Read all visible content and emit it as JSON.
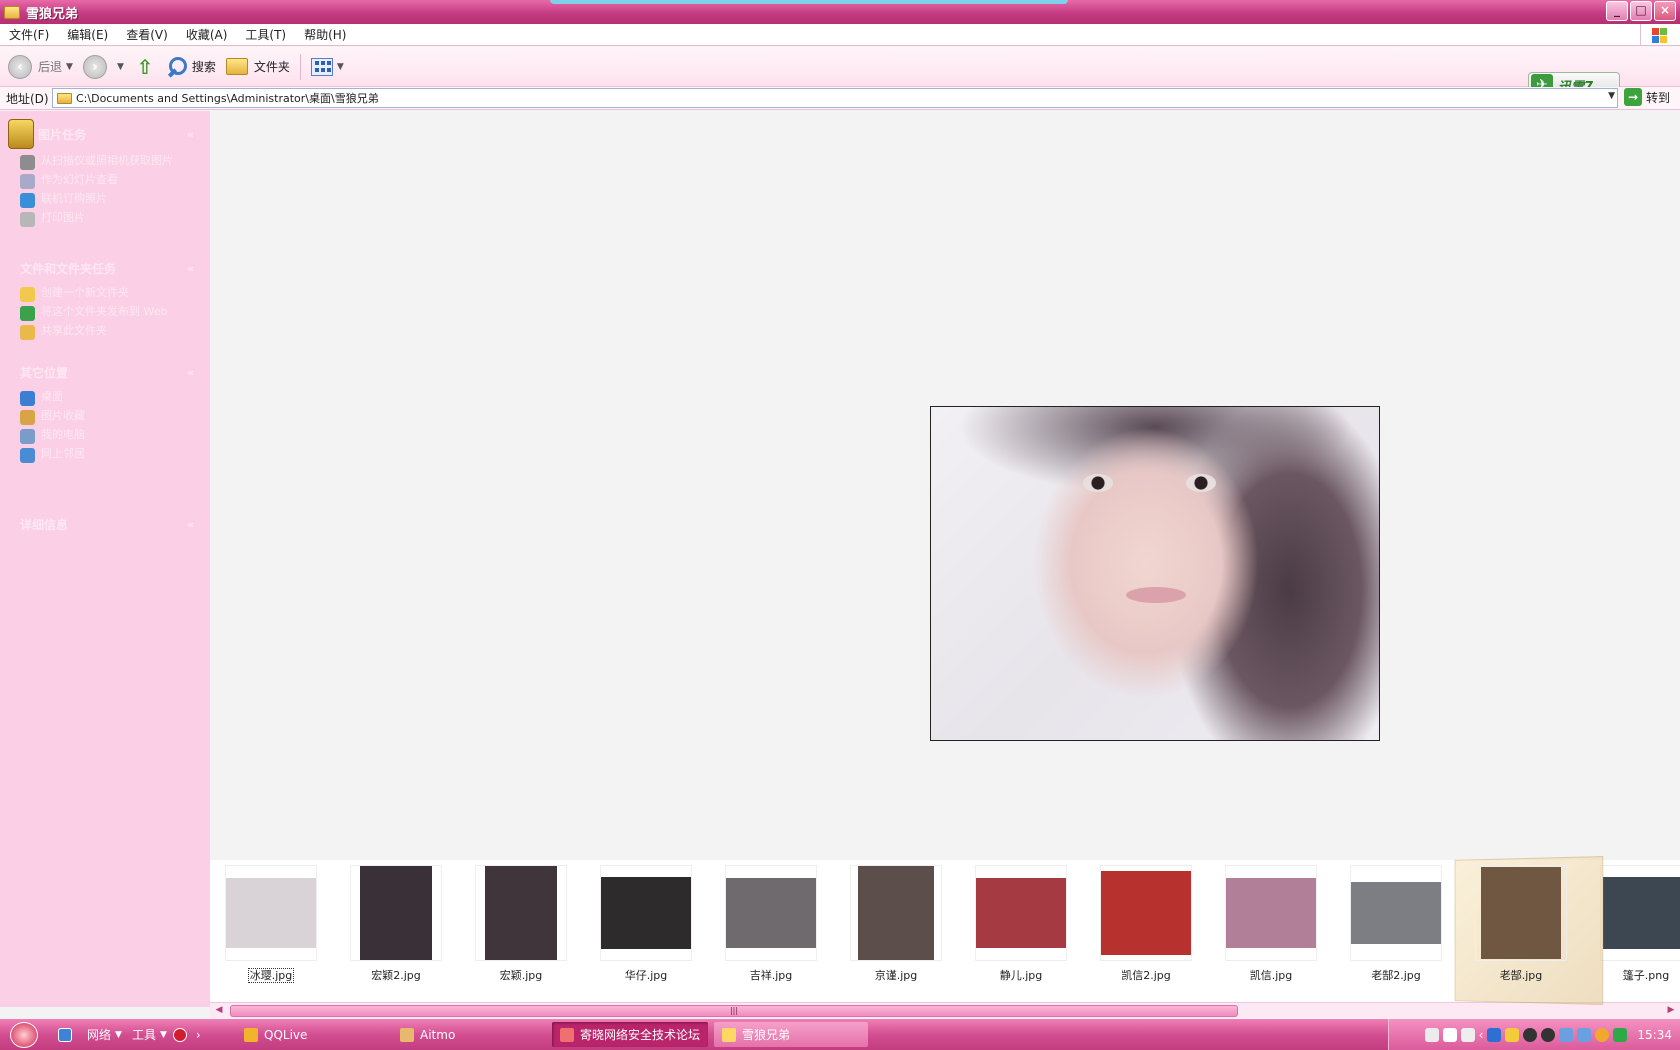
{
  "window": {
    "title": "雪狼兄弟",
    "controls": [
      "_",
      "□",
      "×"
    ]
  },
  "menu": [
    "文件(F)",
    "编辑(E)",
    "查看(V)",
    "收藏(A)",
    "工具(T)",
    "帮助(H)"
  ],
  "toolbar": {
    "back": "后退",
    "search": "搜索",
    "folders": "文件夹"
  },
  "address": {
    "label": "地址(D)",
    "path": "C:\\Documents and Settings\\Administrator\\桌面\\雪狼兄弟",
    "go": "转到"
  },
  "xunlei": {
    "label": "迅雷7"
  },
  "tasks": {
    "picture": {
      "title": "图片任务",
      "items": [
        "从扫描仪或照相机获取图片",
        "作为幻灯片查看",
        "联机订购照片",
        "打印图片"
      ]
    },
    "file": {
      "title": "文件和文件夹任务",
      "items": [
        "创建一个新文件夹",
        "将这个文件夹发布到 Web",
        "共享此文件夹"
      ]
    },
    "other": {
      "title": "其它位置",
      "items": [
        "桌面",
        "图片收藏",
        "我的电脑",
        "网上邻居"
      ]
    },
    "details": {
      "title": "详细信息"
    }
  },
  "filmstrip": [
    {
      "name": "冰璎.jpg",
      "selected": true,
      "color": "#d9d2d6"
    },
    {
      "name": "宏颖2.jpg",
      "selected": false,
      "color": "#3a3037"
    },
    {
      "name": "宏颖.jpg",
      "selected": false,
      "color": "#40353a"
    },
    {
      "name": "华仔.jpg",
      "selected": false,
      "color": "#2e2b2d"
    },
    {
      "name": "吉祥.jpg",
      "selected": false,
      "color": "#6f6a6d"
    },
    {
      "name": "京谨.jpg",
      "selected": false,
      "color": "#5c4e4a"
    },
    {
      "name": "静儿.jpg",
      "selected": false,
      "color": "#a53a43"
    },
    {
      "name": "凯信2.jpg",
      "selected": false,
      "color": "#b7322f"
    },
    {
      "name": "凯信.jpg",
      "selected": false,
      "color": "#b27f98"
    },
    {
      "name": "老郜2.jpg",
      "selected": false,
      "color": "#7c7e84"
    },
    {
      "name": "老郜.jpg",
      "selected": false,
      "color": "#6f5742"
    },
    {
      "name": "篷子.png",
      "selected": false,
      "color": "#3c4752"
    }
  ],
  "taskbar": {
    "quick": [
      "网络",
      "工具"
    ],
    "items": [
      "QQLive",
      "Aitmo",
      "寄晓网络安全技术论坛",
      "雪狼兄弟"
    ],
    "clock": "15:34"
  },
  "colors": {
    "titlebar": "#c43c82",
    "taskpane": "#fbd0e6",
    "taskbar": "#d24e90"
  }
}
